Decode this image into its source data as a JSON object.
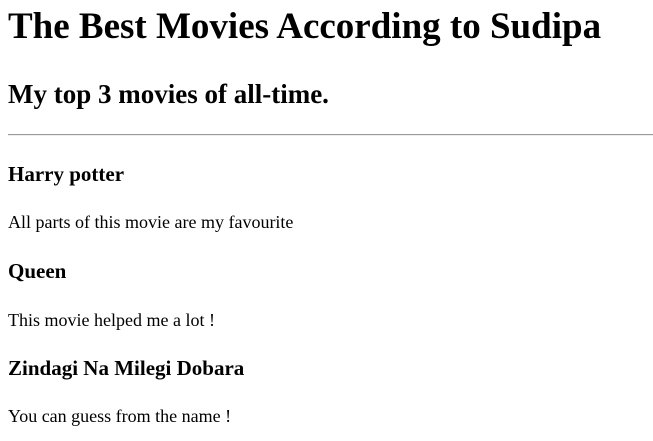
{
  "header": {
    "title": "The Best Movies According to Sudipa",
    "subtitle": "My top 3 movies of all-time."
  },
  "movies": [
    {
      "title": "Harry potter",
      "description": "All parts of this movie are my favourite"
    },
    {
      "title": "Queen",
      "description": "This movie helped me a lot !"
    },
    {
      "title": "Zindagi Na Milegi Dobara",
      "description": "You can guess from the name !"
    }
  ]
}
